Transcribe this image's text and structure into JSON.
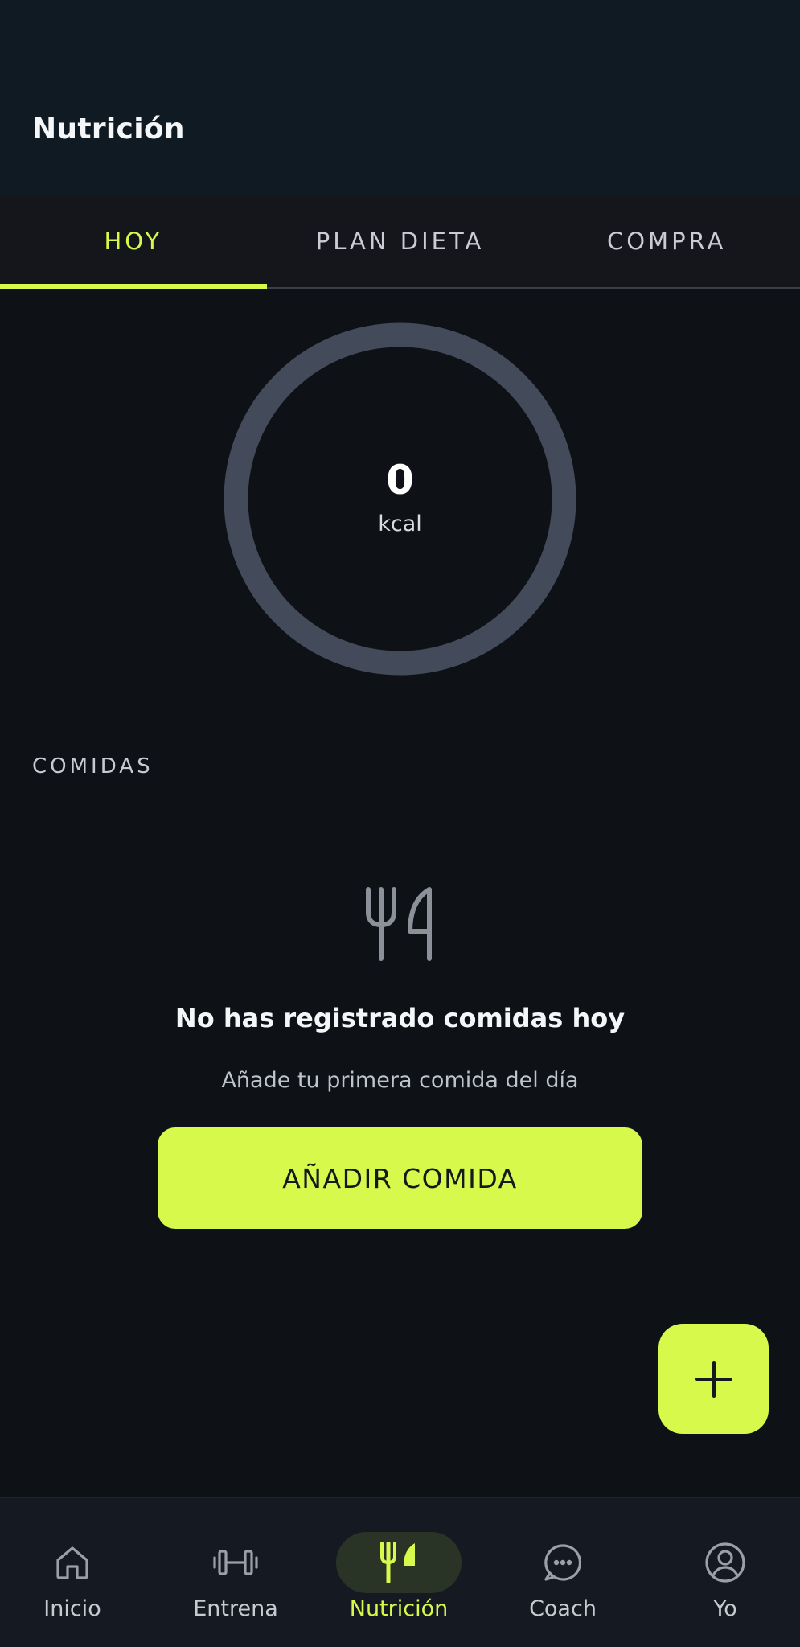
{
  "header": {
    "title": "Nutrición"
  },
  "tabs": [
    {
      "label": "HOY",
      "active": true
    },
    {
      "label": "PLAN DIETA",
      "active": false
    },
    {
      "label": "COMPRA",
      "active": false
    }
  ],
  "calories": {
    "value": "0",
    "unit": "kcal",
    "progress": 0
  },
  "meals": {
    "section_label": "COMIDAS",
    "empty_icon": "utensils-icon",
    "empty_title": "No has registrado comidas hoy",
    "empty_subtitle": "Añade tu primera comida del día",
    "add_button_label": "AÑADIR COMIDA"
  },
  "fab": {
    "icon": "plus-icon"
  },
  "bottom_nav": {
    "items": [
      {
        "label": "Inicio",
        "icon": "home-icon",
        "active": false
      },
      {
        "label": "Entrena",
        "icon": "dumbbell-icon",
        "active": false
      },
      {
        "label": "Nutrición",
        "icon": "utensils-icon",
        "active": true
      },
      {
        "label": "Coach",
        "icon": "chat-icon",
        "active": false
      },
      {
        "label": "Yo",
        "icon": "user-icon",
        "active": false
      }
    ]
  },
  "colors": {
    "accent": "#d6f94b",
    "background": "#0e1116",
    "header_bg": "#101a22",
    "ring_track": "#434a5a"
  }
}
